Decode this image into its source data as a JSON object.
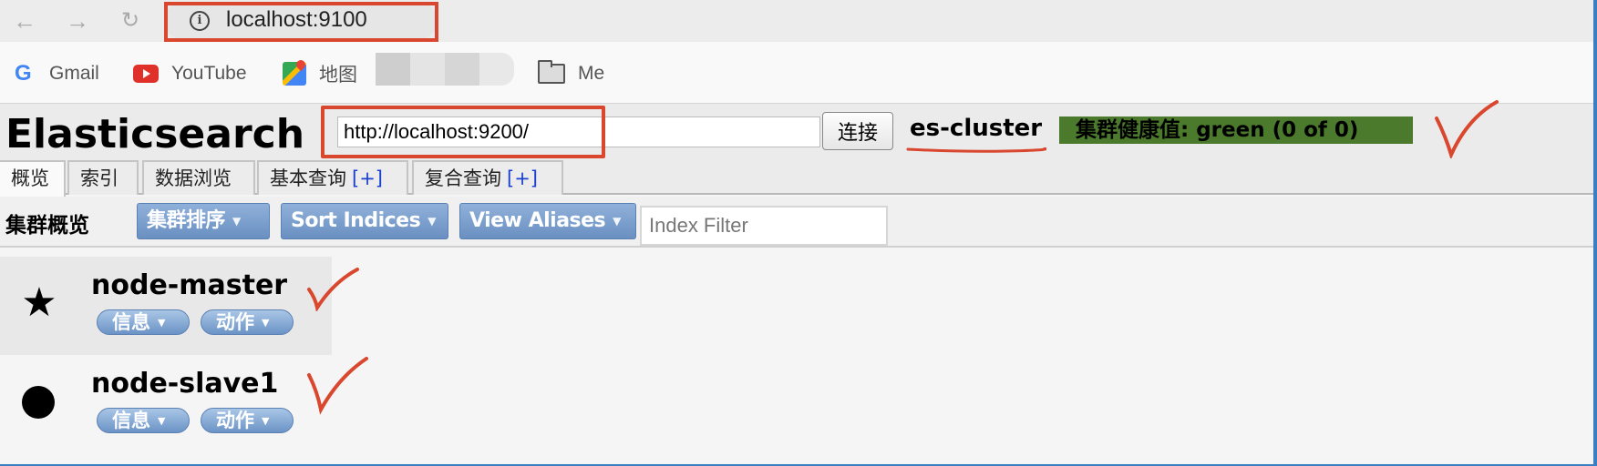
{
  "browser": {
    "url": "localhost:9100",
    "nav": {
      "back": "←",
      "forward": "→",
      "reload": "↻"
    },
    "bookmarks": [
      {
        "label": "Gmail",
        "icon": "google-icon"
      },
      {
        "label": "YouTube",
        "icon": "youtube-icon"
      },
      {
        "label": "地图",
        "icon": "maps-icon"
      },
      {
        "label": "Me",
        "icon": "folder-icon"
      }
    ]
  },
  "app": {
    "logo": "Elasticsearch",
    "connection_uri": "http://localhost:9200/",
    "connect_label": "连接",
    "cluster_name": "es-cluster",
    "health_text": "集群健康值: green (0 of 0)",
    "health_color": "#4b7a2c",
    "tabs": [
      {
        "label": "概览",
        "active": true,
        "plus": ""
      },
      {
        "label": "索引",
        "active": false,
        "plus": ""
      },
      {
        "label": "数据浏览",
        "active": false,
        "plus": ""
      },
      {
        "label": "基本查询",
        "active": false,
        "plus": "[+]"
      },
      {
        "label": "复合查询",
        "active": false,
        "plus": "[+]"
      }
    ],
    "toolbar": {
      "title": "集群概览",
      "buttons": [
        "集群排序",
        "Sort Indices",
        "View Aliases"
      ],
      "filter_placeholder": "Index Filter",
      "filter_value": ""
    },
    "nodes": [
      {
        "name": "node-master",
        "role": "master",
        "icon": "star-icon",
        "info_label": "信息",
        "action_label": "动作"
      },
      {
        "name": "node-slave1",
        "role": "data",
        "icon": "dot-icon",
        "info_label": "信息",
        "action_label": "动作"
      }
    ]
  },
  "annotations": {
    "color": "#d9472e"
  },
  "glyphs": {
    "star": "★",
    "caret": "▼",
    "info": "i"
  }
}
